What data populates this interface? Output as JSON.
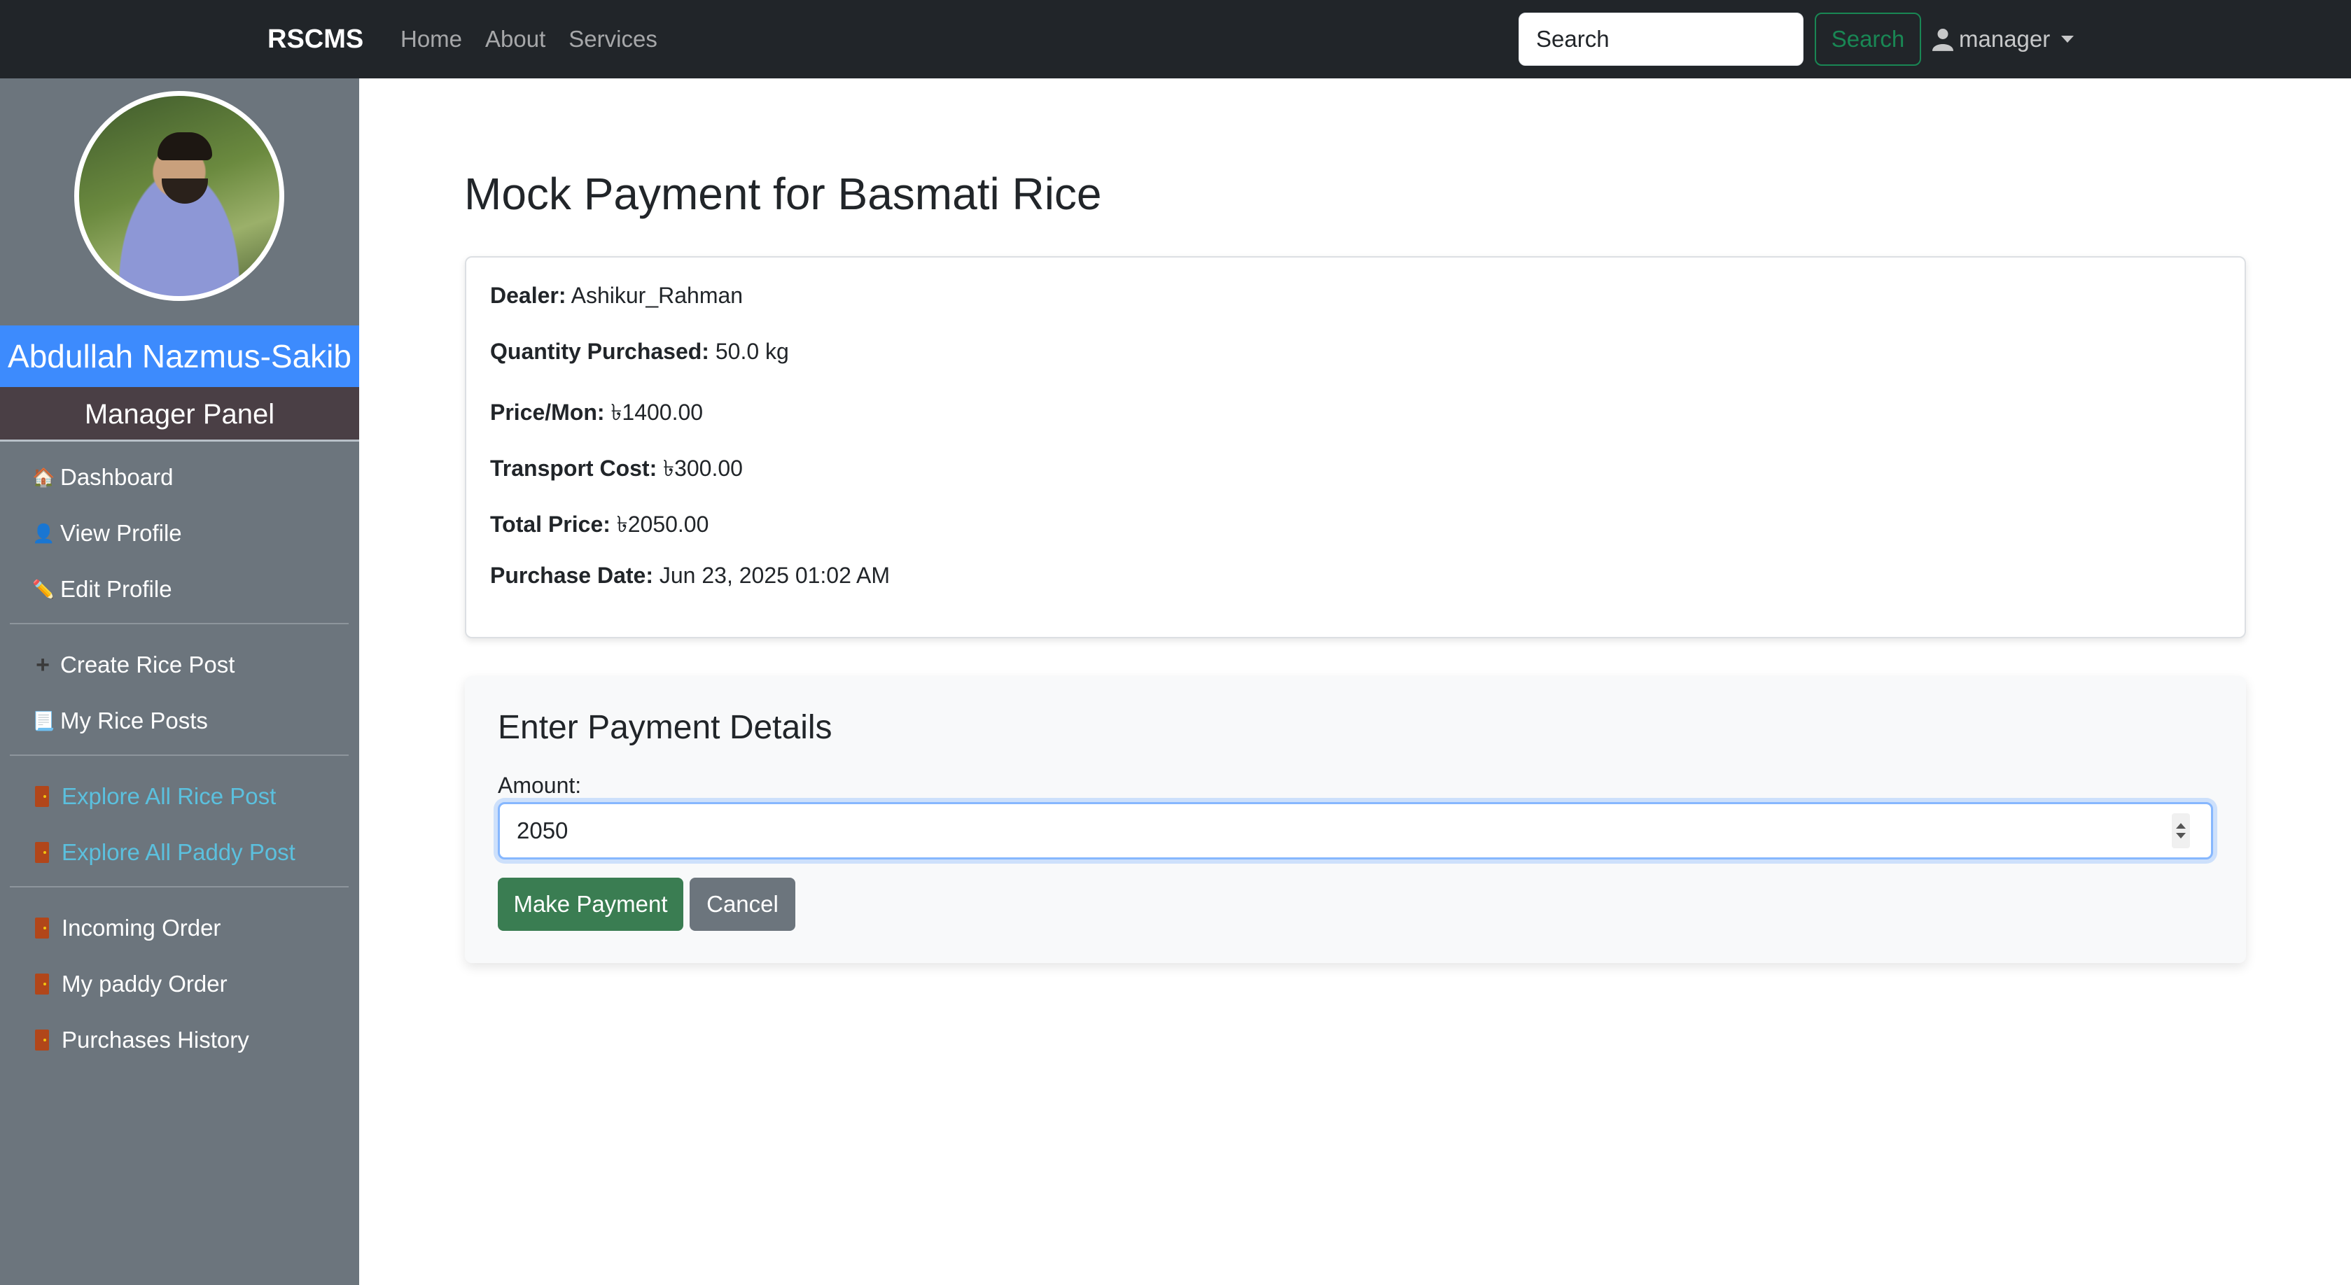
{
  "navbar": {
    "brand": "RSCMS",
    "links": [
      "Home",
      "About",
      "Services"
    ],
    "search_placeholder": "Search",
    "search_button": "Search",
    "user_label": "manager"
  },
  "sidebar": {
    "user_name": "Abdullah Nazmus-Sakib",
    "panel_title": "Manager Panel",
    "items": [
      {
        "label": "Dashboard",
        "icon": "house-icon"
      },
      {
        "label": "View Profile",
        "icon": "user-icon"
      },
      {
        "label": "Edit Profile",
        "icon": "pencil-icon"
      },
      {
        "label": "Create Rice Post",
        "icon": "plus-icon"
      },
      {
        "label": "My Rice Posts",
        "icon": "document-icon"
      },
      {
        "label": "Explore All Rice Post",
        "icon": "door-icon"
      },
      {
        "label": "Explore All Paddy Post",
        "icon": "door-icon"
      },
      {
        "label": "Incoming Order",
        "icon": "door-icon"
      },
      {
        "label": "My paddy Order",
        "icon": "door-icon"
      },
      {
        "label": "Purchases History",
        "icon": "door-icon"
      }
    ],
    "link_color": "#5bc0de",
    "name_bg": "#3d8bfd"
  },
  "main": {
    "title": "Mock Payment for Basmati Rice",
    "details": [
      {
        "label": "Dealer:",
        "value": "Ashikur_Rahman"
      },
      {
        "label": "Quantity Purchased:",
        "value": "50.0 kg"
      },
      {
        "label": "Price/Mon:",
        "value": "৳1400.00"
      },
      {
        "label": "Transport Cost:",
        "value": "৳300.00"
      },
      {
        "label": "Total Price:",
        "value": "৳2050.00"
      },
      {
        "label": "Purchase Date:",
        "value": "Jun 23, 2025 01:02 AM"
      }
    ],
    "payment": {
      "title": "Enter Payment Details",
      "amount_label": "Amount:",
      "amount_value": "2050",
      "submit_label": "Make Payment",
      "cancel_label": "Cancel"
    }
  },
  "colors": {
    "navbar_bg": "#212529",
    "sidebar_bg": "#6c757d",
    "success": "#198754",
    "pay_button": "#3a7d52"
  }
}
